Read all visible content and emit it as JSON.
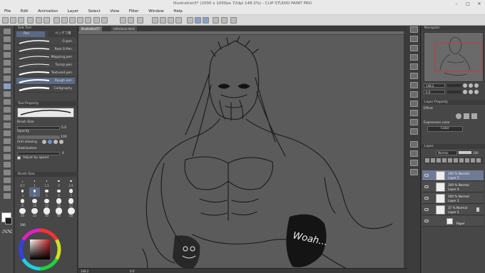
{
  "window": {
    "title": "Illustration5* (1000 x 1000px 72dpi 148.2%) - CLIP STUDIO PAINT PRO"
  },
  "menu": [
    "File",
    "Edit",
    "Animation",
    "Layer",
    "Select",
    "View",
    "Filter",
    "Window",
    "Help"
  ],
  "subtool": {
    "header": "Sub Tool",
    "tabs": [
      "Pen",
      "ペンデフ用"
    ],
    "brushes": [
      {
        "label": "G-pen"
      },
      {
        "label": "Real G-Pen"
      },
      {
        "label": "Mapping pen"
      },
      {
        "label": "Turnip pen"
      },
      {
        "label": "Textured pen"
      },
      {
        "label": "Rough pen"
      },
      {
        "label": "Calligraphy"
      }
    ],
    "selected_index": 5
  },
  "tool_property": {
    "header": "Tool Property",
    "brush_name": "Rough pen",
    "brush_size_label": "Brush Size",
    "brush_size_value": "5.0",
    "opacity_label": "Opacity",
    "opacity_value": "100",
    "anti_aliasing_label": "Anti-aliasing",
    "stabilization_label": "Stabilization",
    "stabilization_value": "4",
    "adjust_by_speed_label": "Adjust by speed"
  },
  "brush_size_panel": {
    "header": "Brush Size",
    "sizes": [
      "0.7",
      "1",
      "1.5",
      "2",
      "2.5",
      "3",
      "4",
      "5",
      "6",
      "7",
      "8",
      "10",
      "12",
      "15",
      "17",
      "20",
      "25",
      "30",
      "40",
      "50"
    ]
  },
  "color": {
    "main": "#ffffff",
    "sub": "#202020",
    "wheel_value": "100"
  },
  "canvas": {
    "tabs": [
      "illustration5*",
      "reference desk"
    ],
    "zoom": "148.2",
    "background_color": "#5b5b5b",
    "annotation_text": "Woah..."
  },
  "navigator": {
    "header": "Navigator",
    "zoom": "148.2",
    "rotation": "0.0"
  },
  "layer_property": {
    "header": "Layer Property",
    "effect_label": "Effect",
    "expression_color_label": "Expression color",
    "expression_color_value": "Color"
  },
  "layers_panel": {
    "header": "Layer",
    "blend_mode": "Normal",
    "opacity": "100",
    "layers": [
      {
        "line1": "100 % Normal",
        "line2": "Layer 5",
        "selected": true
      },
      {
        "line1": "100 % Normal",
        "line2": "Layer 4",
        "selected": false
      },
      {
        "line1": "100 % Normal",
        "line2": "Layer 1",
        "selected": false
      },
      {
        "line1": "37 % Normal",
        "line2": "Layer 2",
        "selected": false
      },
      {
        "line1": "",
        "line2": "Paper",
        "selected": false
      }
    ]
  },
  "statusbar": {
    "zoom": "148.2",
    "rotation": "0.0"
  }
}
